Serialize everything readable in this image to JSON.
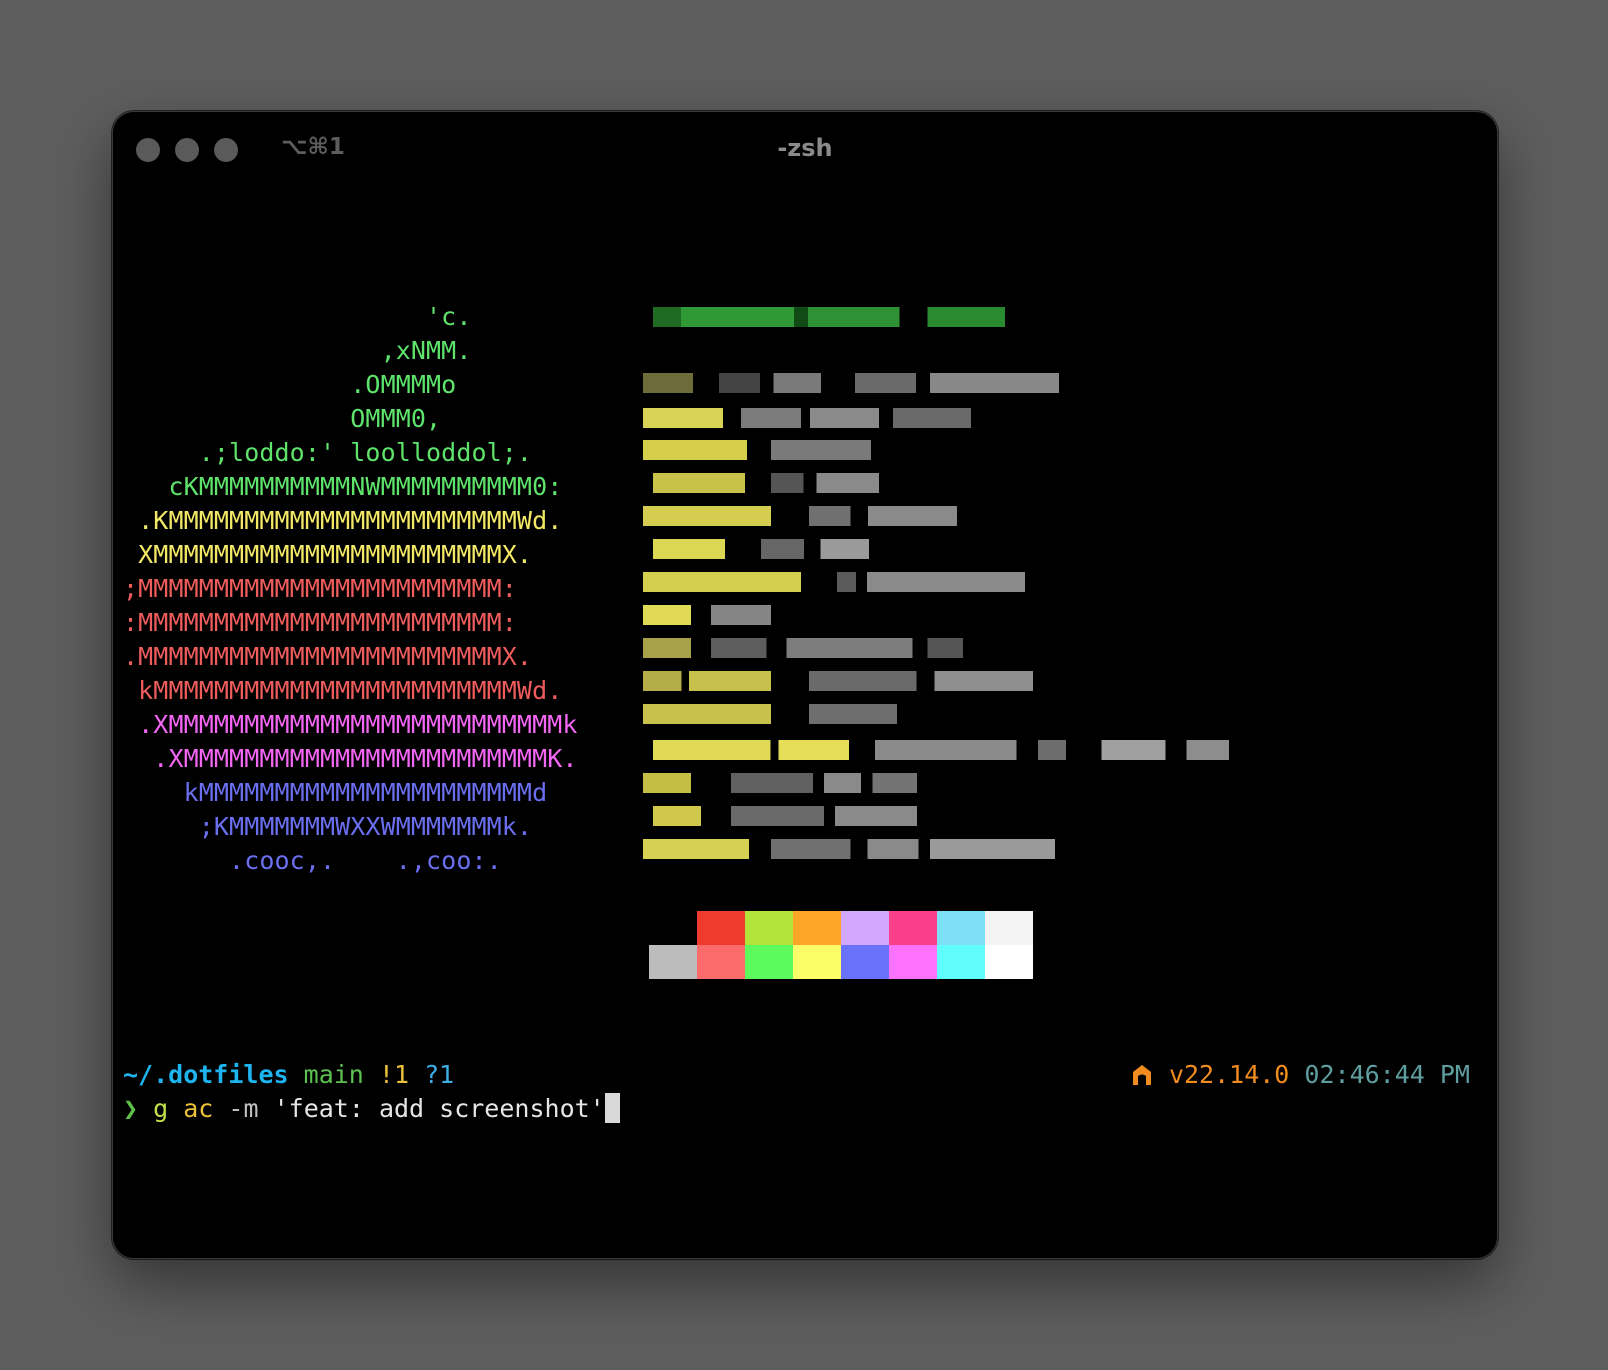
{
  "window": {
    "shortcut": "⌥⌘1",
    "title": "-zsh"
  },
  "logo_lines": [
    {
      "text": "                    'c.",
      "color": "#5ee36b"
    },
    {
      "text": "                 ,xNMM.",
      "color": "#5ee36b"
    },
    {
      "text": "               .OMMMMo",
      "color": "#5ee36b"
    },
    {
      "text": "               OMMM0,",
      "color": "#5ee36b"
    },
    {
      "text": "     .;loddo:' loolloddol;.",
      "color": "#5ee36b"
    },
    {
      "text": "   cKMMMMMMMMMMNWMMMMMMMMMM0:",
      "color": "#5ee36b"
    },
    {
      "text": " .KMMMMMMMMMMMMMMMMMMMMMMMWd.",
      "color": "#f4e966"
    },
    {
      "text": " XMMMMMMMMMMMMMMMMMMMMMMMX.",
      "color": "#f4e966"
    },
    {
      "text": ";MMMMMMMMMMMMMMMMMMMMMMMM:",
      "color": "#ee5c5c"
    },
    {
      "text": ":MMMMMMMMMMMMMMMMMMMMMMMM:",
      "color": "#ee5c5c"
    },
    {
      "text": ".MMMMMMMMMMMMMMMMMMMMMMMMX.",
      "color": "#ee5c5c"
    },
    {
      "text": " kMMMMMMMMMMMMMMMMMMMMMMMMWd.",
      "color": "#ee5c5c"
    },
    {
      "text": " .XMMMMMMMMMMMMMMMMMMMMMMMMMMk",
      "color": "#f466f4"
    },
    {
      "text": "  .XMMMMMMMMMMMMMMMMMMMMMMMMK.",
      "color": "#f466f4"
    },
    {
      "text": "    kMMMMMMMMMMMMMMMMMMMMMMd",
      "color": "#6a6ff0"
    },
    {
      "text": "     ;KMMMMMMMWXXWMMMMMMMk.",
      "color": "#6a6ff0"
    },
    {
      "text": "       .cooc,.    .,coo:.",
      "color": "#6a6ff0"
    }
  ],
  "palette": {
    "top": [
      "#000000",
      "#ef3b2c",
      "#b3e43b",
      "#fda527",
      "#d2a8fc",
      "#fb3e8a",
      "#7de0f5",
      "#f4f4f4"
    ],
    "bottom": [
      "#bcbcbc",
      "#fb6b6b",
      "#5cfa5c",
      "#fdfd6a",
      "#6a72fb",
      "#fd72fd",
      "#61fdfd",
      "#ffffff"
    ]
  },
  "prompt": {
    "path": "~/.dotfiles",
    "branch": "main",
    "modified": "!1",
    "untracked": "?1",
    "node_version": "v22.14.0",
    "time": "02:46:44 PM",
    "symbol": "❯",
    "cmd_g": "g",
    "cmd_ac": "ac",
    "cmd_flag": "-m",
    "cmd_arg": "'feat: add screenshot'"
  },
  "colors": {
    "path": "#1eb4f0",
    "branch": "#5cc24f",
    "modified": "#e9c239",
    "untracked": "#3ab0e6",
    "node": "#f28c1f",
    "time": "#5f9ea0",
    "symbol": "#5ec24a",
    "cmd_g": "#c2e14a",
    "cmd_ac": "#ecc13a",
    "cmd_flag": "#c0c0c0",
    "cmd_arg": "#e6e6e6"
  }
}
